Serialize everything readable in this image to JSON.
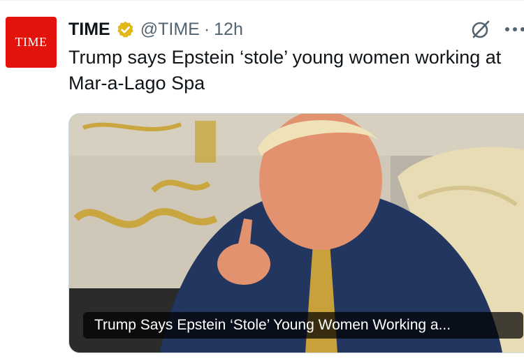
{
  "account": {
    "avatar_text": "TIME",
    "name": "TIME",
    "handle": "@TIME",
    "separator": "·",
    "time": "12h",
    "verified_badge": "gold-verified-badge-icon"
  },
  "actions": {
    "grok_icon": "grok-icon",
    "more_icon": "more-options-icon"
  },
  "tweet": {
    "text": "Trump says Epstein ‘stole’ young women working at\nMar-a-Lago Spa"
  },
  "card": {
    "caption": "Trump Says Epstein ‘Stole’ Young Women Working a..."
  },
  "colors": {
    "brand_red": "#e3120b",
    "verified_gold": "#e2b719",
    "text_primary": "#0f1419",
    "text_secondary": "#536471"
  }
}
